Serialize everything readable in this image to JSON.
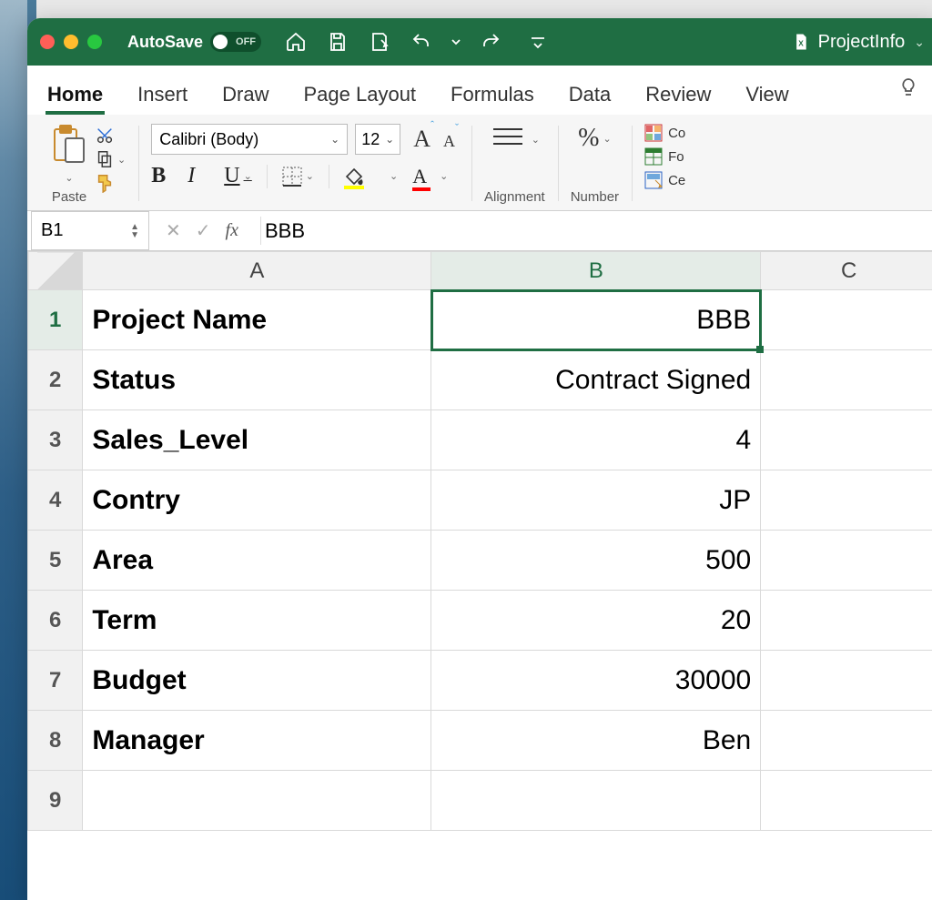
{
  "titlebar": {
    "autosave_label": "AutoSave",
    "autosave_state": "OFF",
    "doc_name": "ProjectInfo"
  },
  "tabs": {
    "home": "Home",
    "insert": "Insert",
    "draw": "Draw",
    "page_layout": "Page Layout",
    "formulas": "Formulas",
    "data": "Data",
    "review": "Review",
    "view": "View"
  },
  "ribbon": {
    "paste_label": "Paste",
    "font_name": "Calibri (Body)",
    "font_size": "12",
    "alignment_label": "Alignment",
    "number_label": "Number",
    "cond_fmt": "Conditional Formatting",
    "fmt_table": "Format as Table",
    "cell_styles": "Cell Styles",
    "cond_fmt_short": "Co",
    "fmt_table_short": "Fo",
    "cell_styles_short": "Ce"
  },
  "formula_bar": {
    "name_box": "B1",
    "fx_label": "fx",
    "value": "BBB"
  },
  "grid": {
    "columns": [
      "A",
      "B",
      "C"
    ],
    "selected_col_index": 1,
    "selected_row_index": 0,
    "rows": [
      {
        "n": "1",
        "a": "Project Name",
        "b": "BBB"
      },
      {
        "n": "2",
        "a": "Status",
        "b": "Contract Signed"
      },
      {
        "n": "3",
        "a": "Sales_Level",
        "b": "4"
      },
      {
        "n": "4",
        "a": "Contry",
        "b": "JP"
      },
      {
        "n": "5",
        "a": "Area",
        "b": "500"
      },
      {
        "n": "6",
        "a": "Term",
        "b": "20"
      },
      {
        "n": "7",
        "a": "Budget",
        "b": "30000"
      },
      {
        "n": "8",
        "a": "Manager",
        "b": "Ben"
      },
      {
        "n": "9",
        "a": "",
        "b": ""
      }
    ]
  }
}
